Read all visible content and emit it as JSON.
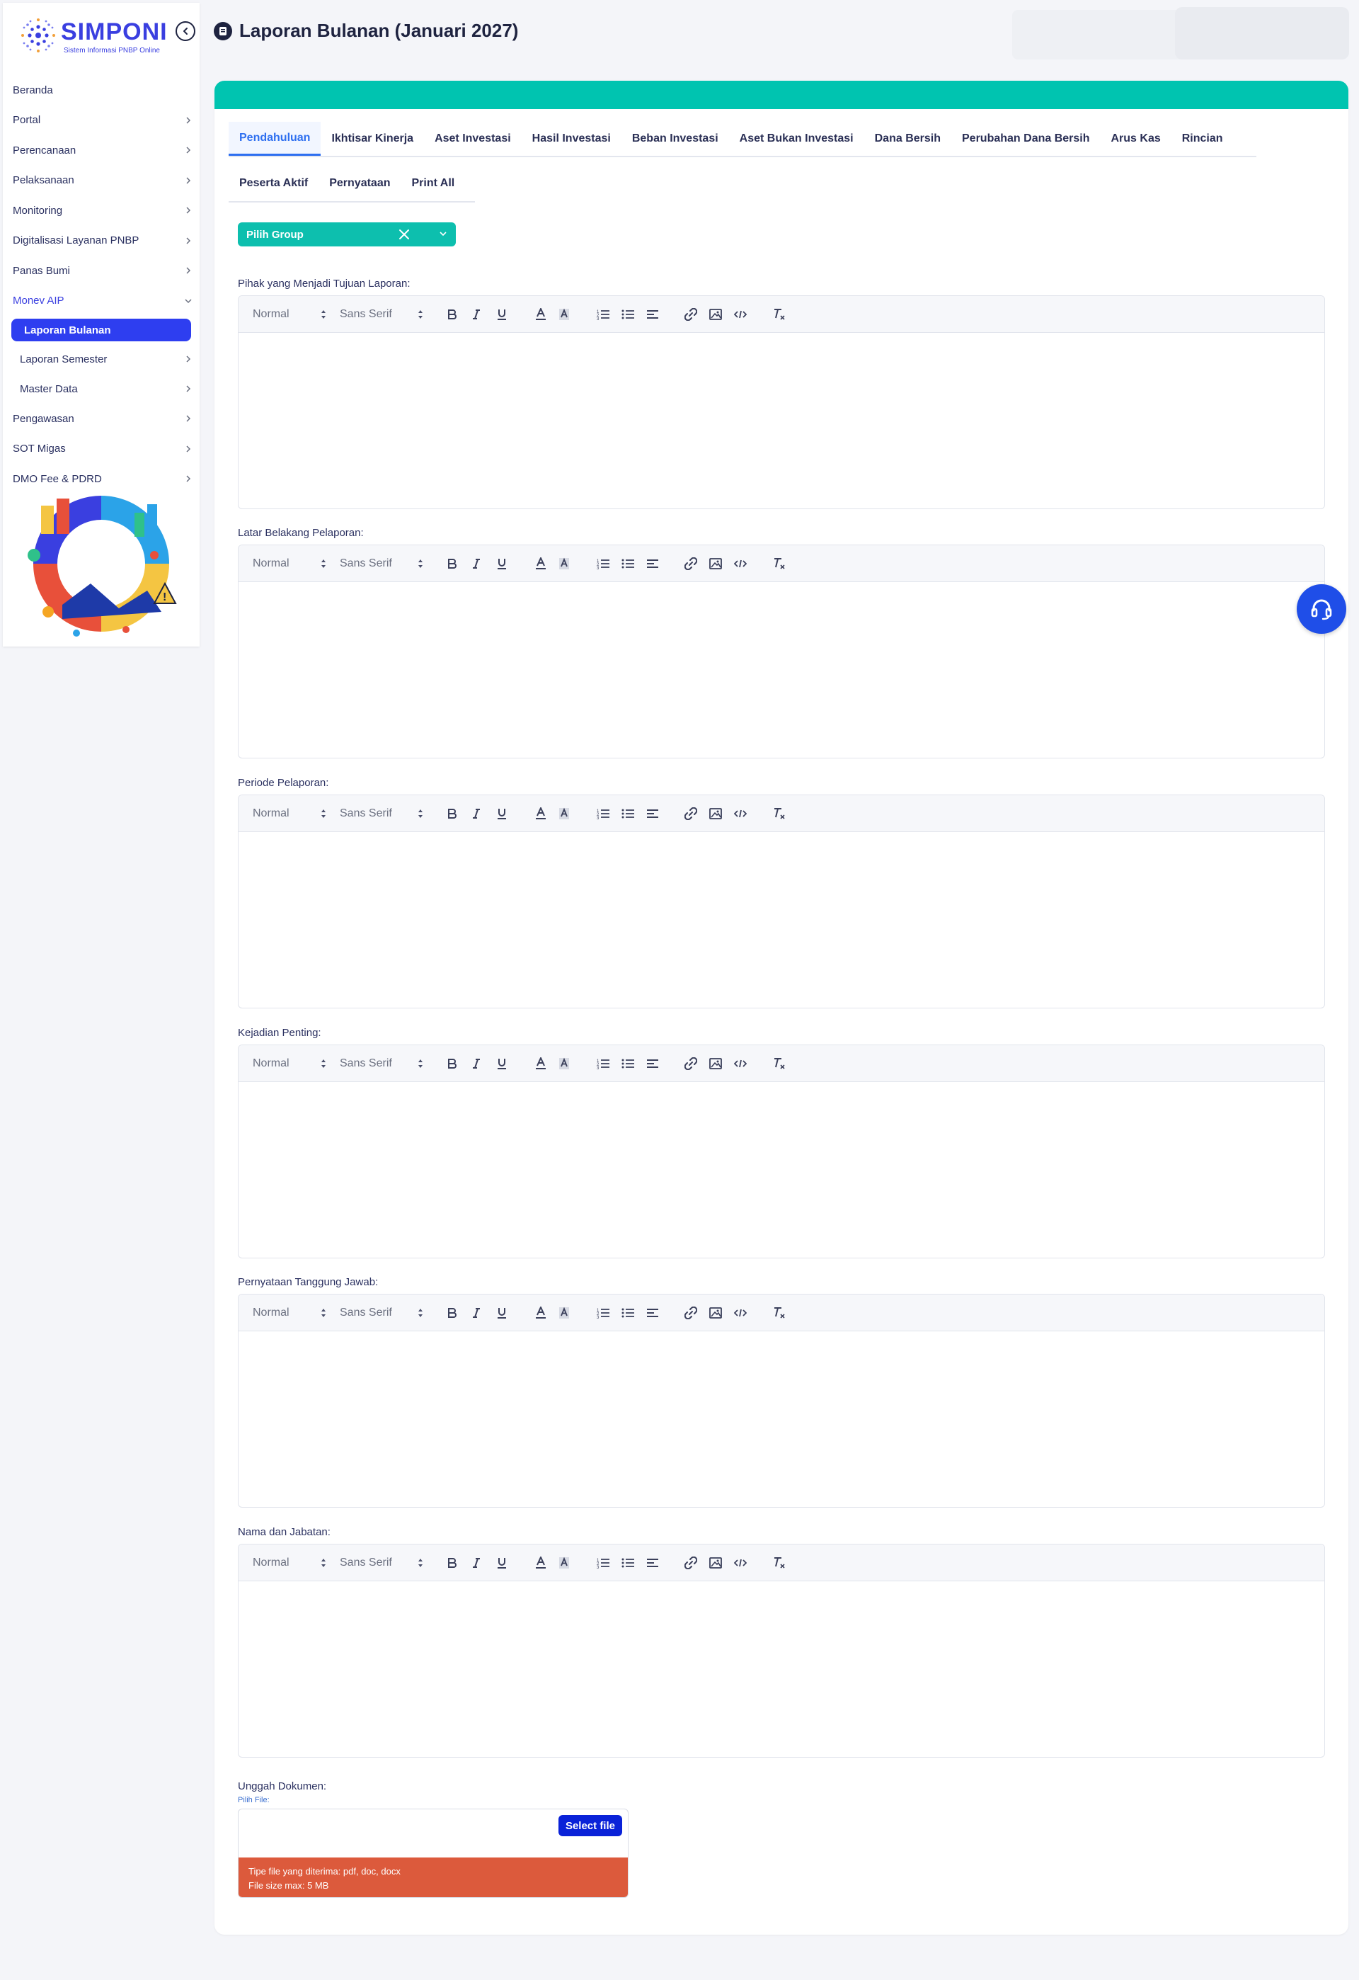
{
  "app": {
    "logo_text": "SIMPONI",
    "logo_subtitle": "Sistem Informasi PNBP Online"
  },
  "sidebar": {
    "items": [
      {
        "label": "Beranda"
      },
      {
        "label": "Portal"
      },
      {
        "label": "Perencanaan"
      },
      {
        "label": "Pelaksanaan"
      },
      {
        "label": "Monitoring"
      },
      {
        "label": "Digitalisasi Layanan PNBP"
      },
      {
        "label": "Panas Bumi"
      },
      {
        "label": "Monev AIP"
      },
      {
        "label": "Pengawasan"
      },
      {
        "label": "SOT Migas"
      },
      {
        "label": "DMO Fee & PDRD"
      }
    ],
    "monev_sub": [
      {
        "label": "Laporan Bulanan"
      },
      {
        "label": "Laporan Semester"
      },
      {
        "label": "Master Data"
      }
    ]
  },
  "header": {
    "title": "Laporan Bulanan (Januari 2027)"
  },
  "tabs": {
    "row1": [
      "Pendahuluan",
      "Ikhtisar Kinerja",
      "Aset Investasi",
      "Hasil Investasi",
      "Beban Investasi",
      "Aset Bukan Investasi",
      "Dana Bersih",
      "Perubahan Dana Bersih",
      "Arus Kas",
      "Rincian"
    ],
    "row2": [
      "Peserta Aktif",
      "Pernyataan",
      "Print All"
    ],
    "active": "Pendahuluan"
  },
  "group_select": {
    "value": "Pilih Group"
  },
  "editor_toolbar": {
    "size": "Normal",
    "font": "Sans Serif"
  },
  "fields": [
    {
      "label": "Pihak yang Menjadi Tujuan Laporan:"
    },
    {
      "label": "Latar Belakang Pelaporan:"
    },
    {
      "label": "Periode Pelaporan:"
    },
    {
      "label": "Kejadian Penting:"
    },
    {
      "label": "Pernyataan Tanggung Jawab:"
    },
    {
      "label": "Nama dan Jabatan:"
    }
  ],
  "upload": {
    "label": "Unggah Dokumen:",
    "sub_label": "Pilih File:",
    "button": "Select file",
    "hint_types": "Tipe file yang diterima: pdf, doc, docx",
    "hint_size": "File size max: 5 MB"
  },
  "colors": {
    "brand": "#3a3fe0",
    "teal": "#00c4b0",
    "active_tab": "#2e6ff0",
    "upload_hint": "#dc5a3c",
    "help_fab": "#1f4ee8"
  }
}
